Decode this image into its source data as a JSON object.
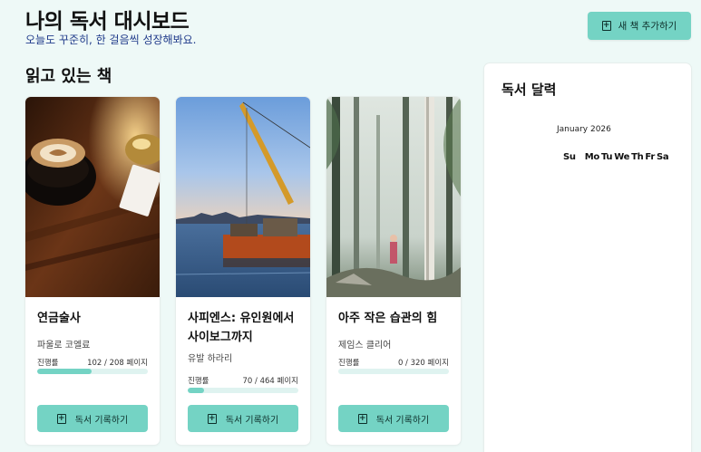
{
  "header": {
    "title": "나의 독서 대시보드",
    "subtitle": "오늘도 꾸준히, 한 걸음씩 성장해봐요.",
    "add_book_label": "새 책 추가하기"
  },
  "reading": {
    "section_title": "읽고 있는 책",
    "progress_label": "진행률",
    "log_button_label": "독서 기록하기",
    "books": [
      {
        "title": "연금술사",
        "author": "파울로 코엘료",
        "pages_text": "102 / 208 페이지",
        "progress": 0.49,
        "cover": "coffee-cup-icon"
      },
      {
        "title": "사피엔스: 유인원에서 사이보그까지",
        "author": "유발 하라리",
        "pages_text": "70 / 464 페이지",
        "progress": 0.15,
        "cover": "harbor-crane-icon"
      },
      {
        "title": "아주 작은 습관의 힘",
        "author": "제임스 클리어",
        "pages_text": "0 / 320 페이지",
        "progress": 0.0,
        "cover": "forest-icon"
      }
    ]
  },
  "calendar": {
    "title": "독서 달력",
    "month": "January 2026",
    "weekdays": [
      "Su",
      "Mo",
      "Tu",
      "We",
      "Th",
      "Fr",
      "Sa"
    ]
  },
  "colors": {
    "accent": "#74d3c4",
    "background": "#eef9f7",
    "track": "#dff3f0"
  }
}
